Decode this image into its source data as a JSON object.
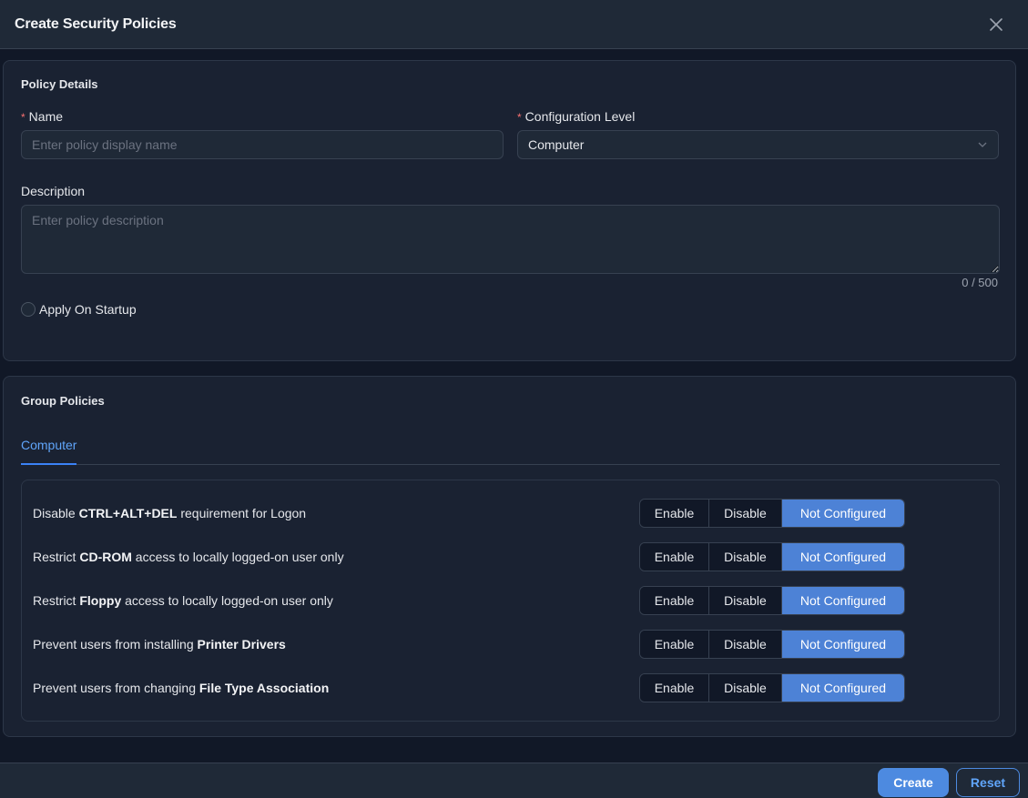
{
  "dialog": {
    "title": "Create Security Policies"
  },
  "policy_details": {
    "title": "Policy Details",
    "name": {
      "label": "Name",
      "placeholder": "Enter policy display name",
      "value": ""
    },
    "configuration_level": {
      "label": "Configuration Level",
      "value": "Computer"
    },
    "description": {
      "label": "Description",
      "placeholder": "Enter policy description",
      "value": "",
      "counter": "0 / 500"
    },
    "apply_on_startup": {
      "label": "Apply On Startup",
      "checked": false
    }
  },
  "group_policies": {
    "title": "Group Policies",
    "tabs": [
      {
        "label": "Computer",
        "active": true
      }
    ],
    "options": [
      "Enable",
      "Disable",
      "Not Configured"
    ],
    "policies": [
      {
        "prefix": "Disable ",
        "bold": "CTRL+ALT+DEL",
        "suffix": " requirement for Logon",
        "selected": "Not Configured"
      },
      {
        "prefix": "Restrict ",
        "bold": "CD-ROM",
        "suffix": " access to locally logged-on user only",
        "selected": "Not Configured"
      },
      {
        "prefix": "Restrict ",
        "bold": "Floppy",
        "suffix": " access to locally logged-on user only",
        "selected": "Not Configured"
      },
      {
        "prefix": "Prevent users from installing ",
        "bold": "Printer Drivers",
        "suffix": "",
        "selected": "Not Configured"
      },
      {
        "prefix": "Prevent users from changing ",
        "bold": "File Type Association",
        "suffix": "",
        "selected": "Not Configured"
      }
    ]
  },
  "footer": {
    "create_label": "Create",
    "reset_label": "Reset"
  },
  "colors": {
    "accent": "#4d8ae0",
    "required": "#f87171",
    "background": "#111827"
  }
}
